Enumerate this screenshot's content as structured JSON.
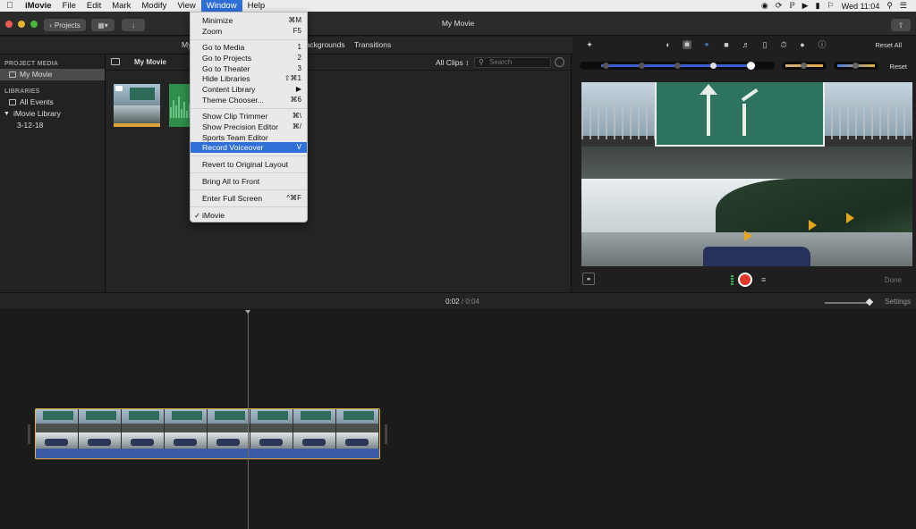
{
  "menubar": {
    "app_name": "iMovie",
    "items": [
      "File",
      "Edit",
      "Mark",
      "Modify",
      "View",
      "Window",
      "Help"
    ],
    "clock": "Wed 11:04"
  },
  "toolbar": {
    "projects_label": "Projects",
    "window_title": "My Movie"
  },
  "media_tabs": {
    "my_media": "My",
    "backgrounds": "Backgrounds",
    "transitions": "Transitions"
  },
  "sidebar": {
    "project_media_header": "PROJECT MEDIA",
    "project_item": "My Movie",
    "libraries_header": "LIBRARIES",
    "all_events": "All Events",
    "library": "iMovie Library",
    "event": "3-12-18"
  },
  "browser": {
    "title": "My Movie",
    "filter": "All Clips",
    "search_placeholder": "Search"
  },
  "viewer": {
    "reset_all": "Reset All",
    "reset": "Reset",
    "done": "Done"
  },
  "timeline": {
    "current_time": "0:02",
    "separator": "/",
    "total_time": "0:04",
    "settings": "Settings"
  },
  "window_menu": {
    "items": [
      {
        "label": "Minimize",
        "shortcut": "⌘M"
      },
      {
        "label": "Zoom",
        "shortcut": "F5"
      },
      {
        "label": "Go to Media",
        "shortcut": "1"
      },
      {
        "label": "Go to Projects",
        "shortcut": "2"
      },
      {
        "label": "Go to Theater",
        "shortcut": "3"
      },
      {
        "label": "Hide Libraries",
        "shortcut": "⇧⌘1"
      },
      {
        "label": "Content Library",
        "shortcut": "▶"
      },
      {
        "label": "Theme Chooser...",
        "shortcut": "⌘6"
      },
      {
        "label": "Show Clip Trimmer",
        "shortcut": "⌘\\"
      },
      {
        "label": "Show Precision Editor",
        "shortcut": "⌘/"
      },
      {
        "label": "Sports Team Editor",
        "shortcut": ""
      },
      {
        "label": "Record Voiceover",
        "shortcut": "V"
      },
      {
        "label": "Revert to Original Layout",
        "shortcut": ""
      },
      {
        "label": "Bring All to Front",
        "shortcut": ""
      },
      {
        "label": "Enter Full Screen",
        "shortcut": "^⌘F"
      },
      {
        "label": "iMovie",
        "shortcut": "",
        "checked": "✓"
      }
    ],
    "highlighted": "Record Voiceover"
  },
  "colors": {
    "menubar_highlight": "#2f6fd8",
    "record": "#e1382b",
    "clip_border": "#e2b23a",
    "slider_fill": "#3c5fd1"
  }
}
